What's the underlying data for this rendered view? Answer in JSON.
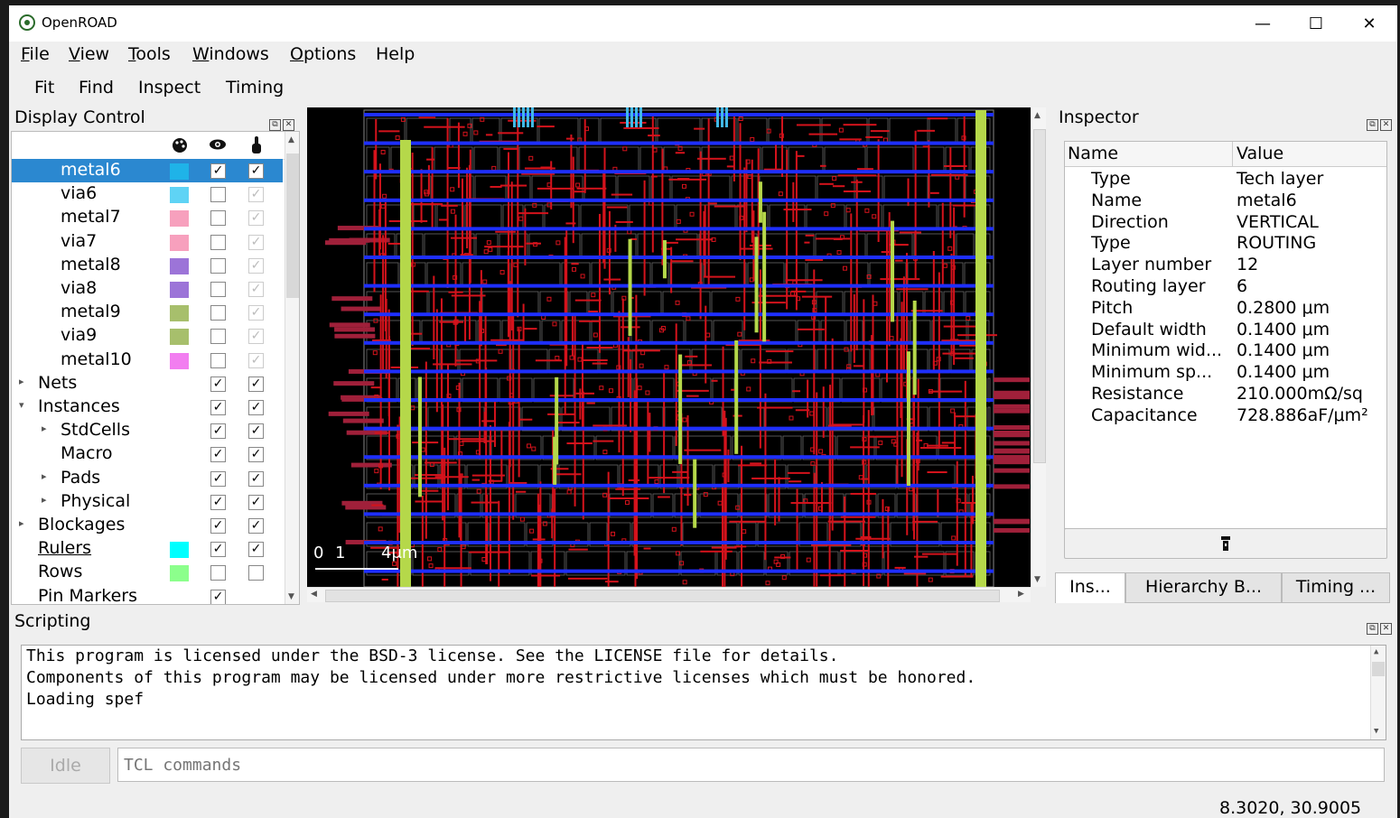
{
  "window": {
    "title": "OpenROAD",
    "controls": [
      "—",
      "☐",
      "✕"
    ]
  },
  "menubar": {
    "items": [
      {
        "mnemonic": "F",
        "rest": "ile"
      },
      {
        "mnemonic": "V",
        "rest": "iew"
      },
      {
        "mnemonic": "T",
        "rest": "ools"
      },
      {
        "mnemonic": "W",
        "rest": "indows"
      },
      {
        "mnemonic": "O",
        "rest": "ptions"
      },
      {
        "mnemonic": "",
        "rest": "Help"
      }
    ]
  },
  "toolbar": {
    "fit": "Fit",
    "find": "Find",
    "inspect": "Inspect",
    "timing": "Timing"
  },
  "display_control": {
    "title": "Display Control",
    "header_icons": [
      "palette-icon",
      "eye-icon",
      "pointer-icon"
    ],
    "rows": [
      {
        "label": "metal6",
        "color": "#1fb3e8",
        "visible": "✓",
        "selectable": "✓",
        "selected": true
      },
      {
        "label": "via6",
        "color": "#5fd3f5",
        "visible": "",
        "selectable": "✓"
      },
      {
        "label": "metal7",
        "color": "#f7a0bd",
        "visible": "",
        "selectable": "✓"
      },
      {
        "label": "via7",
        "color": "#f7a0bd",
        "visible": "",
        "selectable": "✓"
      },
      {
        "label": "metal8",
        "color": "#9c74d8",
        "visible": "",
        "selectable": "✓"
      },
      {
        "label": "via8",
        "color": "#9c74d8",
        "visible": "",
        "selectable": "✓"
      },
      {
        "label": "metal9",
        "color": "#a7bf6c",
        "visible": "",
        "selectable": "✓"
      },
      {
        "label": "via9",
        "color": "#a7bf6c",
        "visible": "",
        "selectable": "✓"
      },
      {
        "label": "metal10",
        "color": "#f27ef0",
        "visible": "",
        "selectable": "✓"
      },
      {
        "label": "Nets",
        "visible": "✓",
        "selectable": "✓",
        "arrow": "▸"
      },
      {
        "label": "Instances",
        "visible": "✓",
        "selectable": "✓",
        "arrow": "▾"
      },
      {
        "label": "StdCells",
        "visible": "✓",
        "selectable": "✓",
        "arrow": "▸",
        "indent": 1
      },
      {
        "label": "Macro",
        "visible": "✓",
        "selectable": "✓",
        "indent": 1
      },
      {
        "label": "Pads",
        "visible": "✓",
        "selectable": "✓",
        "arrow": "▸",
        "indent": 1
      },
      {
        "label": "Physical",
        "visible": "✓",
        "selectable": "✓",
        "arrow": "▸",
        "indent": 1
      },
      {
        "label": "Blockages",
        "visible": "✓",
        "selectable": "✓",
        "arrow": "▸"
      },
      {
        "label": "Rulers",
        "color": "#00ffff",
        "visible": "✓",
        "selectable": "✓",
        "underline": true
      },
      {
        "label": "Rows",
        "color": "#8cff8c",
        "visible": "",
        "selectable": ""
      },
      {
        "label": "Pin Markers",
        "visible": "✓"
      }
    ]
  },
  "layout_view": {
    "scale_labels": [
      "0",
      "1",
      "4μm"
    ],
    "colors": {
      "metal6": "#1e2fff",
      "wires": "#d4131c",
      "power": "#b5d84a",
      "pins": "#a0203a"
    }
  },
  "inspector": {
    "title": "Inspector",
    "columns": [
      "Name",
      "Value"
    ],
    "rows": [
      {
        "name": "Type",
        "value": "Tech layer"
      },
      {
        "name": "Name",
        "value": "metal6"
      },
      {
        "name": "Direction",
        "value": "VERTICAL"
      },
      {
        "name": "Type",
        "value": "ROUTING"
      },
      {
        "name": "Layer number",
        "value": "12"
      },
      {
        "name": "Routing layer",
        "value": "6"
      },
      {
        "name": "Pitch",
        "value": "0.2800 μm"
      },
      {
        "name": "Default width",
        "value": "0.1400 μm"
      },
      {
        "name": "Minimum wid...",
        "value": "0.1400 μm"
      },
      {
        "name": "Minimum sp...",
        "value": "0.1400 μm"
      },
      {
        "name": "Resistance",
        "value": "210.000mΩ/sq"
      },
      {
        "name": "Capacitance",
        "value": "728.886aF/μm²"
      }
    ],
    "tabs": [
      "Ins...",
      "Hierarchy B...",
      "Timing ..."
    ]
  },
  "scripting": {
    "title": "Scripting",
    "output": [
      "This program is licensed under the BSD-3 license. See the LICENSE file for details.",
      "Components of this program may be licensed under more restrictive licenses which must be honored.",
      "Loading spef"
    ],
    "idle_label": "Idle",
    "placeholder": "TCL commands"
  },
  "status": {
    "coordinates": "8.3020, 30.9005"
  }
}
